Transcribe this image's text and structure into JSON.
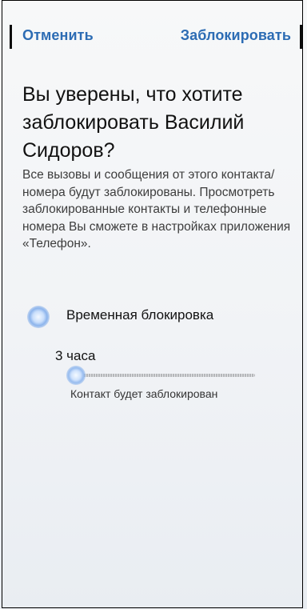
{
  "header": {
    "cancel_label": "Отменить",
    "confirm_label": "Заблокировать"
  },
  "dialog": {
    "title": "Вы уверены, что хотите заблокировать Василий Сидоров?",
    "description": "Все вызовы и сообщения от этого контакта/номера будут заблокированы. Просмотреть заблокированные контакты и телефонные номера Вы сможете в настройках приложения «Телефон».",
    "temporary_block_option": "Временная блокировка",
    "duration_label": "3 часа",
    "duration_level": 0,
    "slider_caption": "Контакт будет заблокирован"
  },
  "colors": {
    "accent": "#2c6cb4",
    "text": "#111111",
    "secondary_text": "#3d3d3d"
  }
}
